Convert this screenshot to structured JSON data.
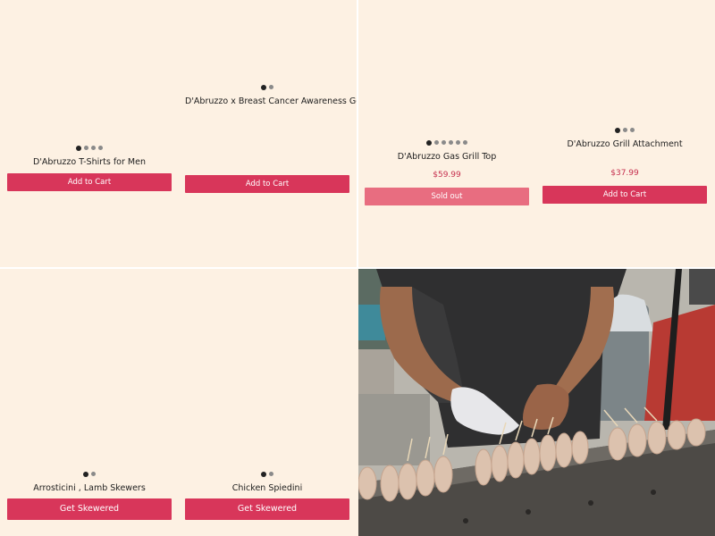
{
  "products_top_left": [
    {
      "title": "D'Abruzzo T-Shirts for Men",
      "button": "Add to Cart"
    },
    {
      "title": "D'Abruzzo x Breast Cancer Awareness Gear",
      "button": "Add to Cart"
    }
  ],
  "products_top_right": [
    {
      "title": "D'Abruzzo Gas Grill Top",
      "price": "$59.99",
      "button": "Sold out"
    },
    {
      "title": "D'Abruzzo Grill Attachment",
      "price": "$37.99",
      "button": "Add to Cart"
    }
  ],
  "products_bottom_left": [
    {
      "title": "Arrosticini , Lamb Skewers",
      "button": "Get Skewered"
    },
    {
      "title": "Chicken Spiedini",
      "button": "Get Skewered"
    }
  ],
  "colors": {
    "background": "#fdf1e3",
    "button": "#d8365a",
    "button_soldout": "#e86d80",
    "price": "#c6304f"
  }
}
